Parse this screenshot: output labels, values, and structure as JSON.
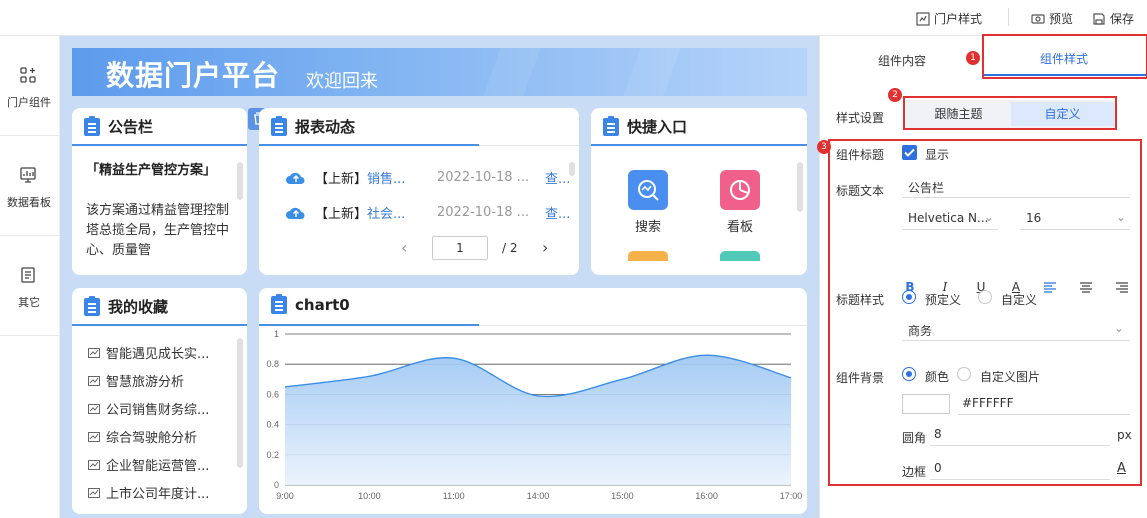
{
  "topbar": {
    "portal_style": "门户样式",
    "preview": "预览",
    "save": "保存"
  },
  "leftnav": {
    "items": [
      {
        "label": "门户组件"
      },
      {
        "label": "数据看板"
      },
      {
        "label": "其它"
      }
    ]
  },
  "banner": {
    "title": "数据门户平台",
    "subtitle": "欢迎回来"
  },
  "notice": {
    "title": "公告栏",
    "heading": "「精益生产管控方案」",
    "body": "该方案通过精益管理控制塔总揽全局，生产管控中心、质量管"
  },
  "reports": {
    "title": "报表动态",
    "rows": [
      {
        "tag": "【上新】",
        "name": "销售...",
        "date": "2022-10-18 ...",
        "action": "查..."
      },
      {
        "tag": "【上新】",
        "name": "社会...",
        "date": "2022-10-18 ...",
        "action": "查..."
      }
    ],
    "pager": {
      "current": "1",
      "total": "/ 2",
      "prev": "‹",
      "next": "›"
    }
  },
  "shortcuts": {
    "title": "快捷入口",
    "items": [
      {
        "label": "搜索",
        "color": "#4a8ff0"
      },
      {
        "label": "看板",
        "color": "#f0608a"
      }
    ]
  },
  "favorites": {
    "title": "我的收藏",
    "items": [
      "智能遇见成长实...",
      "智慧旅游分析",
      "公司销售财务综...",
      "综合驾驶舱分析",
      "企业智能运营管...",
      "上市公司年度计..."
    ]
  },
  "chart": {
    "title": "chart0"
  },
  "chart_data": {
    "type": "area",
    "title": "chart0",
    "x": [
      "9:00",
      "10:00",
      "11:00",
      "14:00",
      "15:00",
      "16:00",
      "17:00"
    ],
    "series": [
      {
        "values": [
          0.65,
          0.72,
          0.84,
          0.59,
          0.7,
          0.86,
          0.71
        ]
      }
    ],
    "y_ticks": [
      "0",
      "0.2",
      "0.4",
      "0.6",
      "0.8",
      "1"
    ],
    "ylim": [
      0,
      1
    ],
    "grid": true,
    "color": "#3a8ee6"
  },
  "panel": {
    "tab_content": "组件内容",
    "tab_style": "组件样式",
    "style_setting_label": "样式设置",
    "follow_theme": "跟随主题",
    "custom": "自定义",
    "component_title_label": "组件标题",
    "show": "显示",
    "title_text_label": "标题文本",
    "title_text_value": "公告栏",
    "font_family": "Helvetica N...",
    "font_size": "16",
    "title_style_label": "标题样式",
    "predefined": "预定义",
    "custom_style": "自定义",
    "style_value": "商务",
    "bg_label": "组件背景",
    "color": "颜色",
    "custom_image": "自定义图片",
    "color_value": "#FFFFFF",
    "radius_label": "圆角",
    "radius_value": "8",
    "radius_unit": "px",
    "border_label": "边框",
    "border_value": "0",
    "badges": [
      "1",
      "2",
      "3"
    ],
    "accent": "#2f6fde",
    "highlight": "#e03030"
  }
}
